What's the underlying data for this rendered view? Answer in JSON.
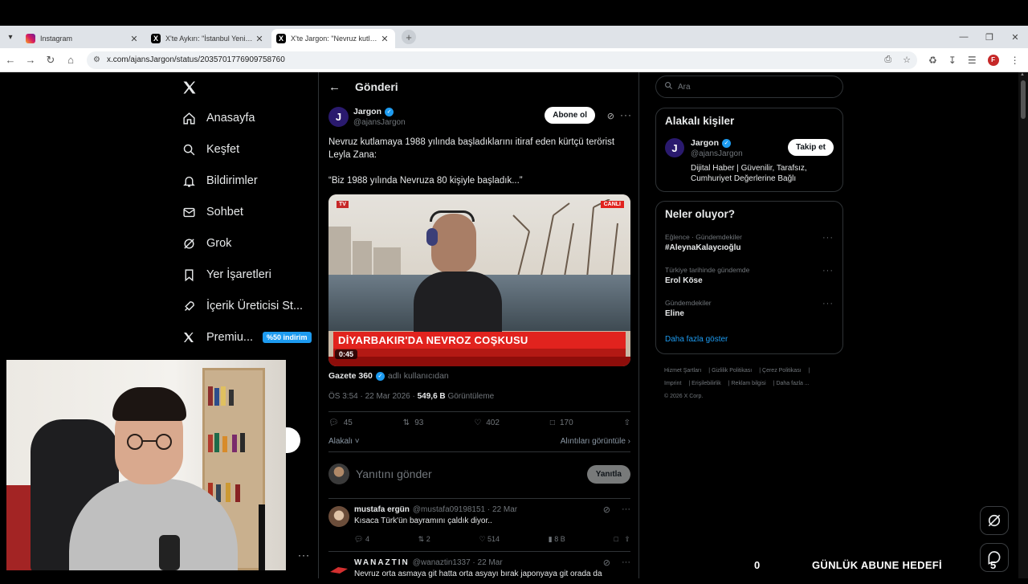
{
  "browser": {
    "tabs": [
      {
        "title": "Instagram",
        "icon": "instagram-icon"
      },
      {
        "title": "X'te Aykırı: \"İstanbul Yenikapı'da",
        "icon": "x-icon"
      },
      {
        "title": "X'te Jargon: \"Nevruz kutlamaya",
        "icon": "x-icon"
      }
    ],
    "url": "x.com/ajansJargon/status/2035701776909758760"
  },
  "nav": {
    "items": [
      {
        "label": "Anasayfa",
        "icon": "home-icon"
      },
      {
        "label": "Keşfet",
        "icon": "search-icon"
      },
      {
        "label": "Bildirimler",
        "icon": "bell-icon"
      },
      {
        "label": "Sohbet",
        "icon": "mail-icon"
      },
      {
        "label": "Grok",
        "icon": "grok-icon"
      },
      {
        "label": "Yer İşaretleri",
        "icon": "bookmark-icon"
      },
      {
        "label": "İçerik Üreticisi St...",
        "icon": "rocket-icon"
      },
      {
        "label": "Premiu...",
        "icon": "x-icon"
      }
    ],
    "premium_badge": "%50 indirim"
  },
  "header": {
    "title": "Gönderi"
  },
  "post": {
    "author_name": "Jargon",
    "author_handle": "@ajansJargon",
    "avatar_letter": "J",
    "subscribe_label": "Abone ol",
    "text_line1": "Nevruz kutlamaya 1988 yılında başladıklarını itiraf eden kürtçü terörist Leyla Zana:",
    "text_line2": "“Biz 1988 yılında Nevruza 80 kişiyle başladık...”",
    "video": {
      "headline": "DİYARBAKIR'DA NEVROZ COŞKUSU",
      "duration": "0:45"
    },
    "source_name": "Gazete 360",
    "source_suffix": "adlı kullanıcıdan",
    "time": "ÖS 3:54 · 22 Mar 2026 ·",
    "views": "549,6 B",
    "views_label": "Görüntüleme",
    "stats": {
      "replies": "45",
      "reposts": "93",
      "likes": "402",
      "bookmarks": "170"
    },
    "related_label": "Alakalı",
    "quotes_label": "Alıntıları görüntüle"
  },
  "reply_box": {
    "placeholder": "Yanıtını gönder",
    "button": "Yanıtla"
  },
  "replies": [
    {
      "name": "mustafa ergün",
      "meta": "@mustafa09198151 · 22 Mar",
      "text": "Kısaca Türk'ün bayramını çaldık diyor..",
      "replies": "4",
      "reposts": "2",
      "likes": "514",
      "views": "8 B"
    },
    {
      "name": "WANAZTIN",
      "meta": "@wanaztin1337 · 22 Mar",
      "text": "Nevruz orta asmaya git hatta orta asyayı bırak japonyaya git orada da"
    }
  ],
  "sidebar": {
    "search_placeholder": "Ara",
    "related_title": "Alakalı kişiler",
    "related_person": {
      "name": "Jargon",
      "handle": "@ajansJargon",
      "bio": "Dijital Haber | Güvenilir, Tarafsız, Cumhuriyet Değerlerine Bağlı",
      "follow": "Takip et"
    },
    "trends_title": "Neler oluyor?",
    "trends": [
      {
        "category": "Eğlence · Gündemdekiler",
        "name": "#AleynaKalaycıoğlu"
      },
      {
        "category": "Türkiye tarihinde gündemde",
        "name": "Erol Köse"
      },
      {
        "category": "Gündemdekiler",
        "name": "Eline"
      }
    ],
    "show_more": "Daha fazla göster",
    "footer": [
      "Hizmet Şartları",
      "Gizlilik Politikası",
      "Çerez Politikası",
      "Imprint",
      "Erişilebilirlik",
      "Reklam bilgisi",
      "Daha fazla ...",
      "© 2026 X Corp."
    ]
  },
  "overlay": {
    "goal_left": "0",
    "goal_title": "GÜNLÜK ABUNE HEDEFİ",
    "goal_right": "5"
  }
}
